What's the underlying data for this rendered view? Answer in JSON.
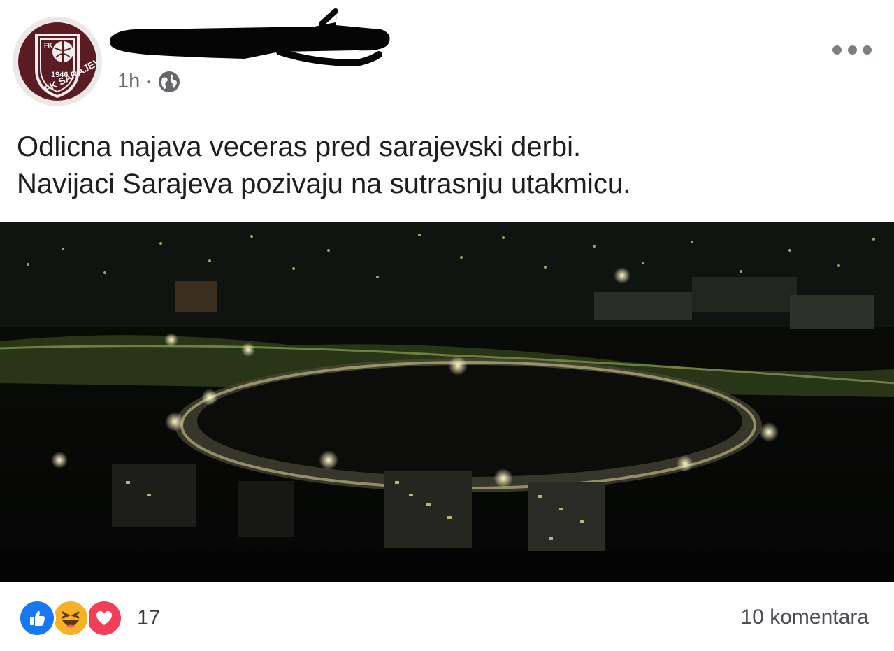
{
  "post": {
    "author": {
      "avatar_icon": "fk-sarajevo-crest-icon",
      "crest_text": "FK SARAJEVO",
      "crest_year": "1946",
      "crest_color": "#5a1c22",
      "name_redacted": true
    },
    "timestamp": "1h",
    "separator": "·",
    "audience_icon": "globe-icon",
    "menu_icon": "more-options-icon",
    "text_lines": [
      "Odlicna najava veceras pred sarajevski derbi.",
      "Navijaci Sarajeva pozivaju na sutrasnju utakmicu."
    ],
    "photo": {
      "subject": "night-stadium-photo"
    },
    "reactions": {
      "icons": [
        "like-icon",
        "haha-icon",
        "love-icon"
      ],
      "count": "17"
    },
    "comments_label": "10 komentara"
  }
}
